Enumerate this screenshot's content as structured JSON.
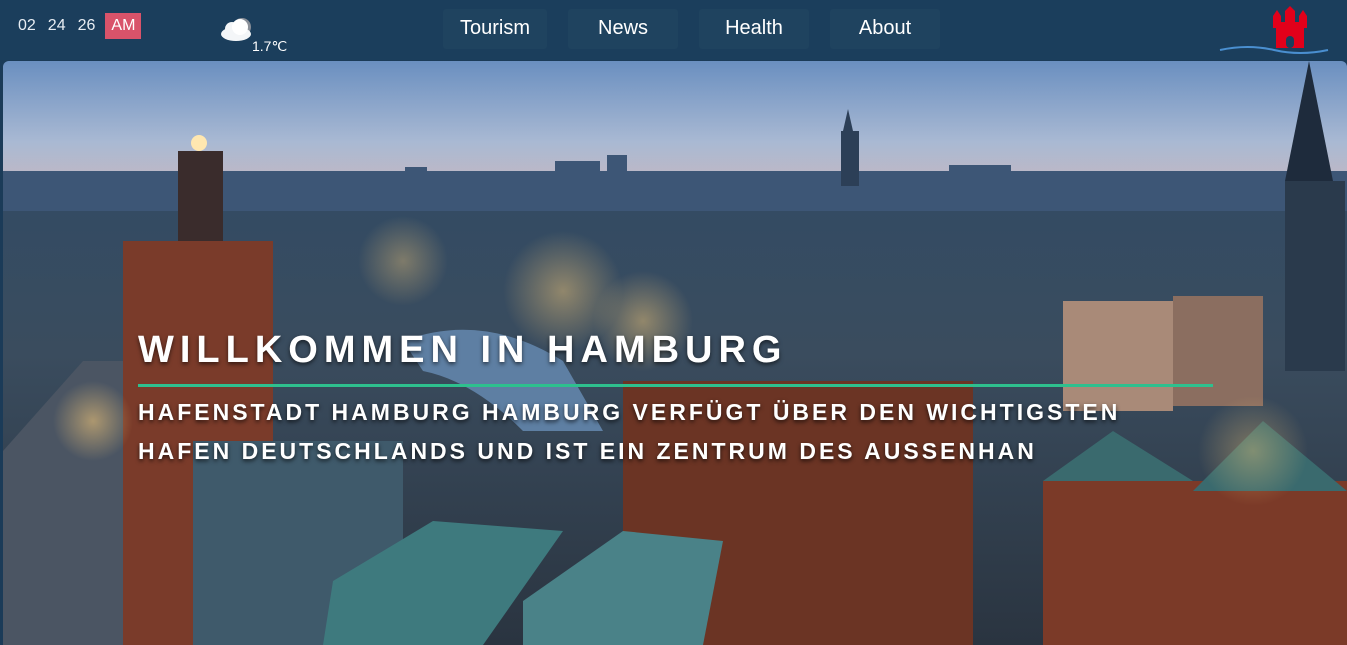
{
  "clock": {
    "hours": "02",
    "minutes": "24",
    "seconds": "26",
    "period": "AM"
  },
  "weather": {
    "temperature": "1.7℃",
    "icon": "cloud-icon"
  },
  "nav": {
    "items": [
      {
        "label": "Tourism"
      },
      {
        "label": "News"
      },
      {
        "label": "Health"
      },
      {
        "label": "About"
      }
    ]
  },
  "logo": {
    "icon": "hamburg-castle-icon",
    "color": "#e2001a"
  },
  "hero": {
    "title": "WILLKOMMEN IN HAMBURG",
    "subtitle": "HAFENSTADT HAMBURG HAMBURG VERFÜGT ÜBER DEN WICHTIGSTEN HAFEN DEUTSCHLANDS UND IST EIN ZENTRUM DES AUSSENHAN",
    "accent_color": "#2ec08e"
  }
}
